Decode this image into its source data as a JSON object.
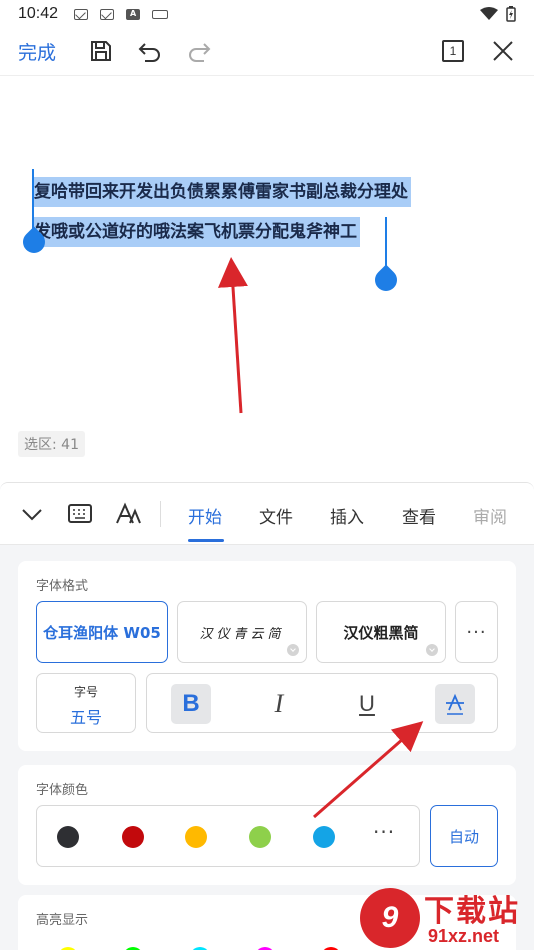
{
  "status_bar": {
    "time": "10:42"
  },
  "toolbar": {
    "done_label": "完成",
    "page_indicator": "1"
  },
  "document": {
    "selected_line1": "复哈带回来开发出负债累累傅雷家书副总裁分理处",
    "selected_line2": "发哦或公道好的哦法案飞机票分配鬼斧神工",
    "selection_count": "选区: 41"
  },
  "tabs": [
    "开始",
    "文件",
    "插入",
    "查看",
    "审阅"
  ],
  "font_format": {
    "title": "字体格式",
    "fonts": [
      "仓耳渔阳体 W05",
      "汉仪青云简",
      "汉仪粗黑简"
    ],
    "more_label": "···",
    "size_label": "字号",
    "size_value": "五号",
    "bold_label": "B",
    "italic_label": "I",
    "underline_label": "U",
    "strike_label": "A"
  },
  "font_color": {
    "title": "字体颜色",
    "colors": [
      "#2e2f33",
      "#c2090c",
      "#ffb900",
      "#8ed04b",
      "#14a4e6"
    ],
    "more_label": "···",
    "auto_label": "自动"
  },
  "highlight": {
    "title": "高亮显示",
    "colors": [
      "#ffff00",
      "#00ff00",
      "#00e5ff",
      "#ff00ff",
      "#ff0000"
    ]
  },
  "watermark": {
    "brand": "下载站",
    "url": "91xz.net",
    "logo": "9"
  },
  "colors": {
    "accent": "#2a6fdb",
    "selection": "#a9cdf7",
    "annotation_arrow": "#d9262b"
  }
}
